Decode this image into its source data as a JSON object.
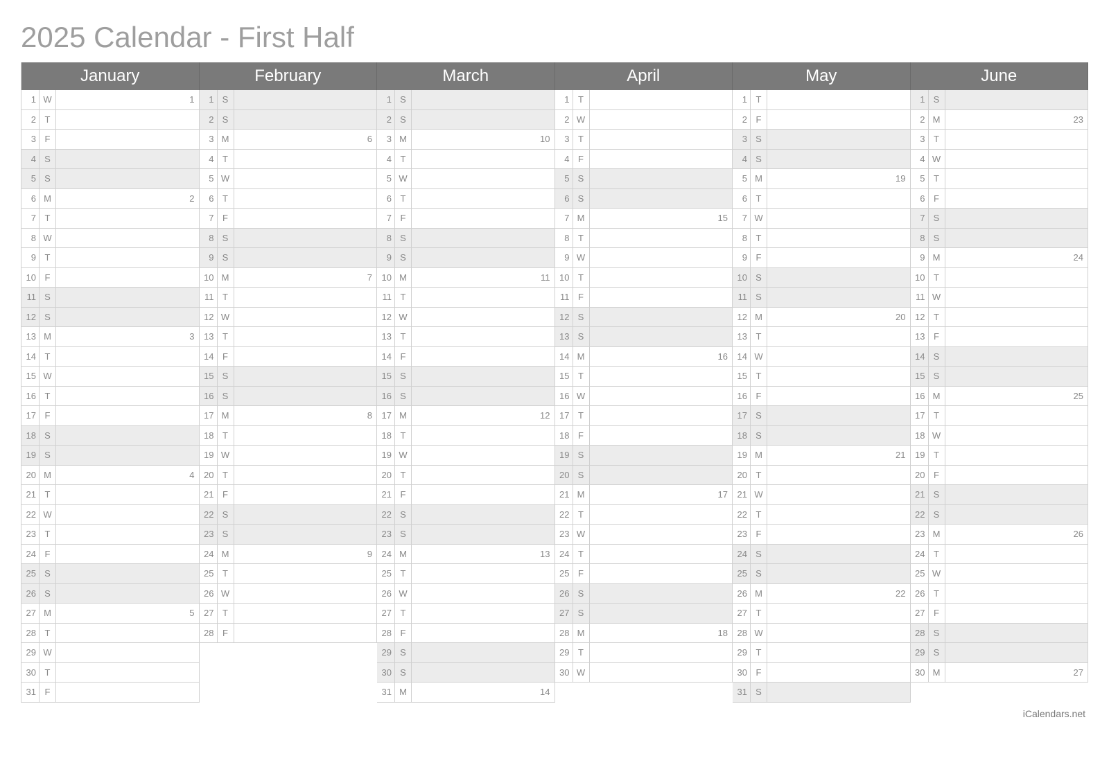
{
  "title": "2025 Calendar - First Half",
  "footer": "iCalendars.net",
  "max_rows": 31,
  "months": [
    {
      "name": "January",
      "days": [
        {
          "n": 1,
          "d": "W",
          "wk": 1,
          "we": false
        },
        {
          "n": 2,
          "d": "T",
          "wk": null,
          "we": false
        },
        {
          "n": 3,
          "d": "F",
          "wk": null,
          "we": false
        },
        {
          "n": 4,
          "d": "S",
          "wk": null,
          "we": true
        },
        {
          "n": 5,
          "d": "S",
          "wk": null,
          "we": true
        },
        {
          "n": 6,
          "d": "M",
          "wk": 2,
          "we": false
        },
        {
          "n": 7,
          "d": "T",
          "wk": null,
          "we": false
        },
        {
          "n": 8,
          "d": "W",
          "wk": null,
          "we": false
        },
        {
          "n": 9,
          "d": "T",
          "wk": null,
          "we": false
        },
        {
          "n": 10,
          "d": "F",
          "wk": null,
          "we": false
        },
        {
          "n": 11,
          "d": "S",
          "wk": null,
          "we": true
        },
        {
          "n": 12,
          "d": "S",
          "wk": null,
          "we": true
        },
        {
          "n": 13,
          "d": "M",
          "wk": 3,
          "we": false
        },
        {
          "n": 14,
          "d": "T",
          "wk": null,
          "we": false
        },
        {
          "n": 15,
          "d": "W",
          "wk": null,
          "we": false
        },
        {
          "n": 16,
          "d": "T",
          "wk": null,
          "we": false
        },
        {
          "n": 17,
          "d": "F",
          "wk": null,
          "we": false
        },
        {
          "n": 18,
          "d": "S",
          "wk": null,
          "we": true
        },
        {
          "n": 19,
          "d": "S",
          "wk": null,
          "we": true
        },
        {
          "n": 20,
          "d": "M",
          "wk": 4,
          "we": false
        },
        {
          "n": 21,
          "d": "T",
          "wk": null,
          "we": false
        },
        {
          "n": 22,
          "d": "W",
          "wk": null,
          "we": false
        },
        {
          "n": 23,
          "d": "T",
          "wk": null,
          "we": false
        },
        {
          "n": 24,
          "d": "F",
          "wk": null,
          "we": false
        },
        {
          "n": 25,
          "d": "S",
          "wk": null,
          "we": true
        },
        {
          "n": 26,
          "d": "S",
          "wk": null,
          "we": true
        },
        {
          "n": 27,
          "d": "M",
          "wk": 5,
          "we": false
        },
        {
          "n": 28,
          "d": "T",
          "wk": null,
          "we": false
        },
        {
          "n": 29,
          "d": "W",
          "wk": null,
          "we": false
        },
        {
          "n": 30,
          "d": "T",
          "wk": null,
          "we": false
        },
        {
          "n": 31,
          "d": "F",
          "wk": null,
          "we": false
        }
      ]
    },
    {
      "name": "February",
      "days": [
        {
          "n": 1,
          "d": "S",
          "wk": null,
          "we": true
        },
        {
          "n": 2,
          "d": "S",
          "wk": null,
          "we": true
        },
        {
          "n": 3,
          "d": "M",
          "wk": 6,
          "we": false
        },
        {
          "n": 4,
          "d": "T",
          "wk": null,
          "we": false
        },
        {
          "n": 5,
          "d": "W",
          "wk": null,
          "we": false
        },
        {
          "n": 6,
          "d": "T",
          "wk": null,
          "we": false
        },
        {
          "n": 7,
          "d": "F",
          "wk": null,
          "we": false
        },
        {
          "n": 8,
          "d": "S",
          "wk": null,
          "we": true
        },
        {
          "n": 9,
          "d": "S",
          "wk": null,
          "we": true
        },
        {
          "n": 10,
          "d": "M",
          "wk": 7,
          "we": false
        },
        {
          "n": 11,
          "d": "T",
          "wk": null,
          "we": false
        },
        {
          "n": 12,
          "d": "W",
          "wk": null,
          "we": false
        },
        {
          "n": 13,
          "d": "T",
          "wk": null,
          "we": false
        },
        {
          "n": 14,
          "d": "F",
          "wk": null,
          "we": false
        },
        {
          "n": 15,
          "d": "S",
          "wk": null,
          "we": true
        },
        {
          "n": 16,
          "d": "S",
          "wk": null,
          "we": true
        },
        {
          "n": 17,
          "d": "M",
          "wk": 8,
          "we": false
        },
        {
          "n": 18,
          "d": "T",
          "wk": null,
          "we": false
        },
        {
          "n": 19,
          "d": "W",
          "wk": null,
          "we": false
        },
        {
          "n": 20,
          "d": "T",
          "wk": null,
          "we": false
        },
        {
          "n": 21,
          "d": "F",
          "wk": null,
          "we": false
        },
        {
          "n": 22,
          "d": "S",
          "wk": null,
          "we": true
        },
        {
          "n": 23,
          "d": "S",
          "wk": null,
          "we": true
        },
        {
          "n": 24,
          "d": "M",
          "wk": 9,
          "we": false
        },
        {
          "n": 25,
          "d": "T",
          "wk": null,
          "we": false
        },
        {
          "n": 26,
          "d": "W",
          "wk": null,
          "we": false
        },
        {
          "n": 27,
          "d": "T",
          "wk": null,
          "we": false
        },
        {
          "n": 28,
          "d": "F",
          "wk": null,
          "we": false
        }
      ]
    },
    {
      "name": "March",
      "days": [
        {
          "n": 1,
          "d": "S",
          "wk": null,
          "we": true
        },
        {
          "n": 2,
          "d": "S",
          "wk": null,
          "we": true
        },
        {
          "n": 3,
          "d": "M",
          "wk": 10,
          "we": false
        },
        {
          "n": 4,
          "d": "T",
          "wk": null,
          "we": false
        },
        {
          "n": 5,
          "d": "W",
          "wk": null,
          "we": false
        },
        {
          "n": 6,
          "d": "T",
          "wk": null,
          "we": false
        },
        {
          "n": 7,
          "d": "F",
          "wk": null,
          "we": false
        },
        {
          "n": 8,
          "d": "S",
          "wk": null,
          "we": true
        },
        {
          "n": 9,
          "d": "S",
          "wk": null,
          "we": true
        },
        {
          "n": 10,
          "d": "M",
          "wk": 11,
          "we": false
        },
        {
          "n": 11,
          "d": "T",
          "wk": null,
          "we": false
        },
        {
          "n": 12,
          "d": "W",
          "wk": null,
          "we": false
        },
        {
          "n": 13,
          "d": "T",
          "wk": null,
          "we": false
        },
        {
          "n": 14,
          "d": "F",
          "wk": null,
          "we": false
        },
        {
          "n": 15,
          "d": "S",
          "wk": null,
          "we": true
        },
        {
          "n": 16,
          "d": "S",
          "wk": null,
          "we": true
        },
        {
          "n": 17,
          "d": "M",
          "wk": 12,
          "we": false
        },
        {
          "n": 18,
          "d": "T",
          "wk": null,
          "we": false
        },
        {
          "n": 19,
          "d": "W",
          "wk": null,
          "we": false
        },
        {
          "n": 20,
          "d": "T",
          "wk": null,
          "we": false
        },
        {
          "n": 21,
          "d": "F",
          "wk": null,
          "we": false
        },
        {
          "n": 22,
          "d": "S",
          "wk": null,
          "we": true
        },
        {
          "n": 23,
          "d": "S",
          "wk": null,
          "we": true
        },
        {
          "n": 24,
          "d": "M",
          "wk": 13,
          "we": false
        },
        {
          "n": 25,
          "d": "T",
          "wk": null,
          "we": false
        },
        {
          "n": 26,
          "d": "W",
          "wk": null,
          "we": false
        },
        {
          "n": 27,
          "d": "T",
          "wk": null,
          "we": false
        },
        {
          "n": 28,
          "d": "F",
          "wk": null,
          "we": false
        },
        {
          "n": 29,
          "d": "S",
          "wk": null,
          "we": true
        },
        {
          "n": 30,
          "d": "S",
          "wk": null,
          "we": true
        },
        {
          "n": 31,
          "d": "M",
          "wk": 14,
          "we": false
        }
      ]
    },
    {
      "name": "April",
      "days": [
        {
          "n": 1,
          "d": "T",
          "wk": null,
          "we": false
        },
        {
          "n": 2,
          "d": "W",
          "wk": null,
          "we": false
        },
        {
          "n": 3,
          "d": "T",
          "wk": null,
          "we": false
        },
        {
          "n": 4,
          "d": "F",
          "wk": null,
          "we": false
        },
        {
          "n": 5,
          "d": "S",
          "wk": null,
          "we": true
        },
        {
          "n": 6,
          "d": "S",
          "wk": null,
          "we": true
        },
        {
          "n": 7,
          "d": "M",
          "wk": 15,
          "we": false
        },
        {
          "n": 8,
          "d": "T",
          "wk": null,
          "we": false
        },
        {
          "n": 9,
          "d": "W",
          "wk": null,
          "we": false
        },
        {
          "n": 10,
          "d": "T",
          "wk": null,
          "we": false
        },
        {
          "n": 11,
          "d": "F",
          "wk": null,
          "we": false
        },
        {
          "n": 12,
          "d": "S",
          "wk": null,
          "we": true
        },
        {
          "n": 13,
          "d": "S",
          "wk": null,
          "we": true
        },
        {
          "n": 14,
          "d": "M",
          "wk": 16,
          "we": false
        },
        {
          "n": 15,
          "d": "T",
          "wk": null,
          "we": false
        },
        {
          "n": 16,
          "d": "W",
          "wk": null,
          "we": false
        },
        {
          "n": 17,
          "d": "T",
          "wk": null,
          "we": false
        },
        {
          "n": 18,
          "d": "F",
          "wk": null,
          "we": false
        },
        {
          "n": 19,
          "d": "S",
          "wk": null,
          "we": true
        },
        {
          "n": 20,
          "d": "S",
          "wk": null,
          "we": true
        },
        {
          "n": 21,
          "d": "M",
          "wk": 17,
          "we": false
        },
        {
          "n": 22,
          "d": "T",
          "wk": null,
          "we": false
        },
        {
          "n": 23,
          "d": "W",
          "wk": null,
          "we": false
        },
        {
          "n": 24,
          "d": "T",
          "wk": null,
          "we": false
        },
        {
          "n": 25,
          "d": "F",
          "wk": null,
          "we": false
        },
        {
          "n": 26,
          "d": "S",
          "wk": null,
          "we": true
        },
        {
          "n": 27,
          "d": "S",
          "wk": null,
          "we": true
        },
        {
          "n": 28,
          "d": "M",
          "wk": 18,
          "we": false
        },
        {
          "n": 29,
          "d": "T",
          "wk": null,
          "we": false
        },
        {
          "n": 30,
          "d": "W",
          "wk": null,
          "we": false
        }
      ]
    },
    {
      "name": "May",
      "days": [
        {
          "n": 1,
          "d": "T",
          "wk": null,
          "we": false
        },
        {
          "n": 2,
          "d": "F",
          "wk": null,
          "we": false
        },
        {
          "n": 3,
          "d": "S",
          "wk": null,
          "we": true
        },
        {
          "n": 4,
          "d": "S",
          "wk": null,
          "we": true
        },
        {
          "n": 5,
          "d": "M",
          "wk": 19,
          "we": false
        },
        {
          "n": 6,
          "d": "T",
          "wk": null,
          "we": false
        },
        {
          "n": 7,
          "d": "W",
          "wk": null,
          "we": false
        },
        {
          "n": 8,
          "d": "T",
          "wk": null,
          "we": false
        },
        {
          "n": 9,
          "d": "F",
          "wk": null,
          "we": false
        },
        {
          "n": 10,
          "d": "S",
          "wk": null,
          "we": true
        },
        {
          "n": 11,
          "d": "S",
          "wk": null,
          "we": true
        },
        {
          "n": 12,
          "d": "M",
          "wk": 20,
          "we": false
        },
        {
          "n": 13,
          "d": "T",
          "wk": null,
          "we": false
        },
        {
          "n": 14,
          "d": "W",
          "wk": null,
          "we": false
        },
        {
          "n": 15,
          "d": "T",
          "wk": null,
          "we": false
        },
        {
          "n": 16,
          "d": "F",
          "wk": null,
          "we": false
        },
        {
          "n": 17,
          "d": "S",
          "wk": null,
          "we": true
        },
        {
          "n": 18,
          "d": "S",
          "wk": null,
          "we": true
        },
        {
          "n": 19,
          "d": "M",
          "wk": 21,
          "we": false
        },
        {
          "n": 20,
          "d": "T",
          "wk": null,
          "we": false
        },
        {
          "n": 21,
          "d": "W",
          "wk": null,
          "we": false
        },
        {
          "n": 22,
          "d": "T",
          "wk": null,
          "we": false
        },
        {
          "n": 23,
          "d": "F",
          "wk": null,
          "we": false
        },
        {
          "n": 24,
          "d": "S",
          "wk": null,
          "we": true
        },
        {
          "n": 25,
          "d": "S",
          "wk": null,
          "we": true
        },
        {
          "n": 26,
          "d": "M",
          "wk": 22,
          "we": false
        },
        {
          "n": 27,
          "d": "T",
          "wk": null,
          "we": false
        },
        {
          "n": 28,
          "d": "W",
          "wk": null,
          "we": false
        },
        {
          "n": 29,
          "d": "T",
          "wk": null,
          "we": false
        },
        {
          "n": 30,
          "d": "F",
          "wk": null,
          "we": false
        },
        {
          "n": 31,
          "d": "S",
          "wk": null,
          "we": true
        }
      ]
    },
    {
      "name": "June",
      "days": [
        {
          "n": 1,
          "d": "S",
          "wk": null,
          "we": true
        },
        {
          "n": 2,
          "d": "M",
          "wk": 23,
          "we": false
        },
        {
          "n": 3,
          "d": "T",
          "wk": null,
          "we": false
        },
        {
          "n": 4,
          "d": "W",
          "wk": null,
          "we": false
        },
        {
          "n": 5,
          "d": "T",
          "wk": null,
          "we": false
        },
        {
          "n": 6,
          "d": "F",
          "wk": null,
          "we": false
        },
        {
          "n": 7,
          "d": "S",
          "wk": null,
          "we": true
        },
        {
          "n": 8,
          "d": "S",
          "wk": null,
          "we": true
        },
        {
          "n": 9,
          "d": "M",
          "wk": 24,
          "we": false
        },
        {
          "n": 10,
          "d": "T",
          "wk": null,
          "we": false
        },
        {
          "n": 11,
          "d": "W",
          "wk": null,
          "we": false
        },
        {
          "n": 12,
          "d": "T",
          "wk": null,
          "we": false
        },
        {
          "n": 13,
          "d": "F",
          "wk": null,
          "we": false
        },
        {
          "n": 14,
          "d": "S",
          "wk": null,
          "we": true
        },
        {
          "n": 15,
          "d": "S",
          "wk": null,
          "we": true
        },
        {
          "n": 16,
          "d": "M",
          "wk": 25,
          "we": false
        },
        {
          "n": 17,
          "d": "T",
          "wk": null,
          "we": false
        },
        {
          "n": 18,
          "d": "W",
          "wk": null,
          "we": false
        },
        {
          "n": 19,
          "d": "T",
          "wk": null,
          "we": false
        },
        {
          "n": 20,
          "d": "F",
          "wk": null,
          "we": false
        },
        {
          "n": 21,
          "d": "S",
          "wk": null,
          "we": true
        },
        {
          "n": 22,
          "d": "S",
          "wk": null,
          "we": true
        },
        {
          "n": 23,
          "d": "M",
          "wk": 26,
          "we": false
        },
        {
          "n": 24,
          "d": "T",
          "wk": null,
          "we": false
        },
        {
          "n": 25,
          "d": "W",
          "wk": null,
          "we": false
        },
        {
          "n": 26,
          "d": "T",
          "wk": null,
          "we": false
        },
        {
          "n": 27,
          "d": "F",
          "wk": null,
          "we": false
        },
        {
          "n": 28,
          "d": "S",
          "wk": null,
          "we": true
        },
        {
          "n": 29,
          "d": "S",
          "wk": null,
          "we": true
        },
        {
          "n": 30,
          "d": "M",
          "wk": 27,
          "we": false
        }
      ]
    }
  ]
}
